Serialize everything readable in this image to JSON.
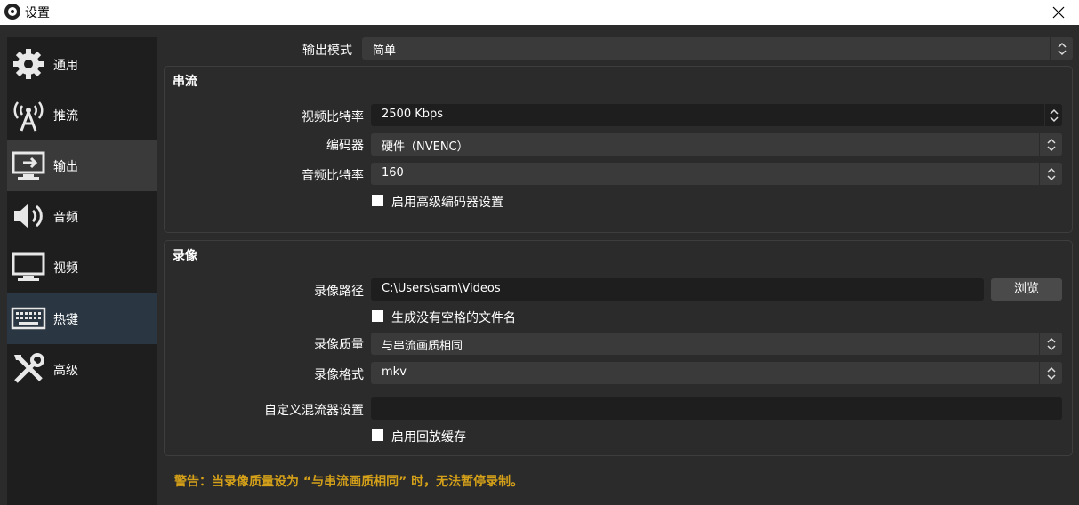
{
  "window": {
    "title": "设置"
  },
  "sidebar": {
    "items": [
      {
        "label": "通用",
        "icon": "gear-icon"
      },
      {
        "label": "推流",
        "icon": "broadcast-antenna-icon"
      },
      {
        "label": "输出",
        "icon": "output-monitor-icon"
      },
      {
        "label": "音频",
        "icon": "speaker-icon"
      },
      {
        "label": "视频",
        "icon": "monitor-icon"
      },
      {
        "label": "热键",
        "icon": "keyboard-icon"
      },
      {
        "label": "高级",
        "icon": "tools-icon"
      }
    ],
    "active_item": "输出"
  },
  "output_mode": {
    "label": "输出模式",
    "value": "简单"
  },
  "streaming": {
    "title": "串流",
    "video_bitrate": {
      "label": "视频比特率",
      "value": "2500 Kbps"
    },
    "encoder": {
      "label": "编码器",
      "value": "硬件（NVENC）"
    },
    "audio_bitrate": {
      "label": "音频比特率",
      "value": "160"
    },
    "advanced_encoder": {
      "label": "启用高级编码器设置",
      "checked": false
    }
  },
  "recording": {
    "title": "录像",
    "path": {
      "label": "录像路径",
      "value": "C:\\Users\\sam\\Videos",
      "browse_label": "浏览"
    },
    "no_space_filename": {
      "label": "生成没有空格的文件名",
      "checked": false
    },
    "quality": {
      "label": "录像质量",
      "value": "与串流画质相同"
    },
    "format": {
      "label": "录像格式",
      "value": "mkv"
    },
    "custom_muxer": {
      "label": "自定义混流器设置",
      "value": ""
    },
    "replay_buffer": {
      "label": "启用回放缓存",
      "checked": false
    }
  },
  "warning": {
    "text": "警告：当录像质量设为 “与串流画质相同” 时，无法暂停录制。",
    "color": "#d4a019"
  },
  "colors": {
    "background": "#2b2b2b",
    "sidebar": "#1e1e1e",
    "field": "#3a3a3a",
    "field_dark": "#1e1e1e"
  }
}
